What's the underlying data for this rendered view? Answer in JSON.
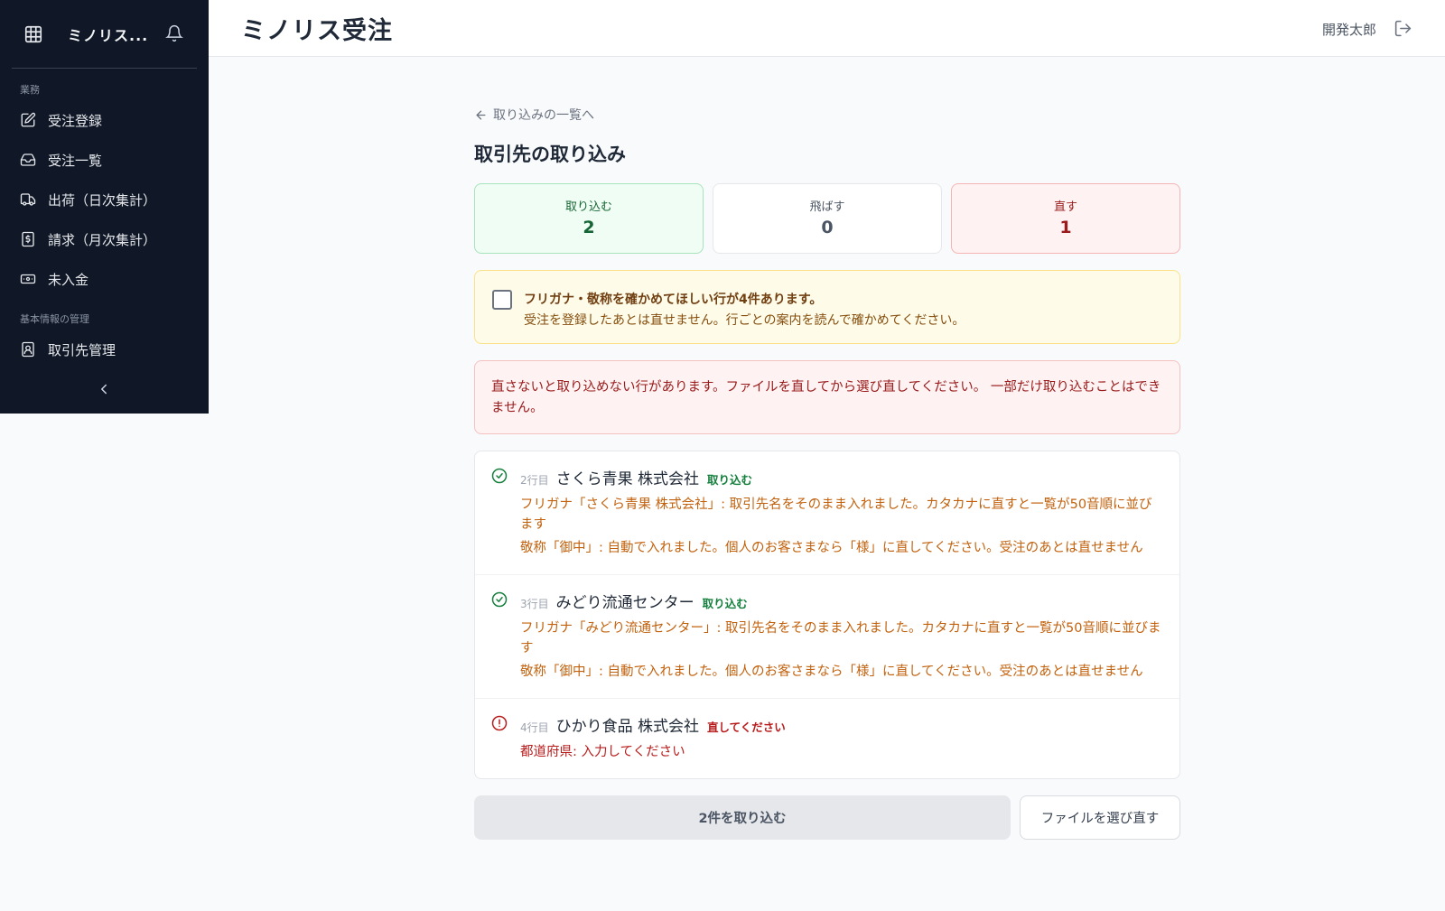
{
  "sidebar": {
    "app_name": "ミノリス...",
    "sections": [
      {
        "label": "業務",
        "items": [
          {
            "label": "受注登録",
            "icon": "edit-icon"
          },
          {
            "label": "受注一覧",
            "icon": "inbox-icon"
          },
          {
            "label": "出荷（日次集計）",
            "icon": "truck-icon"
          },
          {
            "label": "請求（月次集計）",
            "icon": "invoice-icon"
          },
          {
            "label": "未入金",
            "icon": "banknote-icon"
          }
        ]
      },
      {
        "label": "基本情報の管理",
        "items": [
          {
            "label": "取引先管理",
            "icon": "contact-icon"
          }
        ]
      }
    ]
  },
  "header": {
    "title": "ミノリス受注",
    "user_name": "開発太郎"
  },
  "main": {
    "back_link": "取り込みの一覧へ",
    "heading": "取引先の取り込み",
    "stats": [
      {
        "label": "取り込む",
        "value": "2",
        "tone": "green"
      },
      {
        "label": "飛ばす",
        "value": "0",
        "tone": "gray"
      },
      {
        "label": "直す",
        "value": "1",
        "tone": "red"
      }
    ],
    "warning": {
      "title": "フリガナ・敬称を確かめてほしい行が4件あります。",
      "subtitle": "受注を登録したあとは直せません。行ごとの案内を読んで確かめてください。"
    },
    "error": {
      "text": "直さないと取り込めない行があります。ファイルを直してから選び直してください。 一部だけ取り込むことはできません。"
    },
    "rows": [
      {
        "line": "2行目",
        "name": "さくら青果 株式会社",
        "status": "取り込む",
        "ok": true,
        "messages": [
          "フリガナ「さくら青果 株式会社」: 取引先名をそのまま入れました。カタカナに直すと一覧が50音順に並びます",
          "敬称「御中」: 自動で入れました。個人のお客さまなら「様」に直してください。受注のあとは直せません"
        ]
      },
      {
        "line": "3行目",
        "name": "みどり流通センター",
        "status": "取り込む",
        "ok": true,
        "messages": [
          "フリガナ「みどり流通センター」: 取引先名をそのまま入れました。カタカナに直すと一覧が50音順に並びます",
          "敬称「御中」: 自動で入れました。個人のお客さまなら「様」に直してください。受注のあとは直せません"
        ]
      },
      {
        "line": "4行目",
        "name": "ひかり食品 株式会社",
        "status": "直してください",
        "ok": false,
        "messages": [
          "都道府県: 入力してください"
        ]
      }
    ],
    "primary_button": "2件を取り込む",
    "secondary_button": "ファイルを選び直す"
  },
  "colors": {
    "sidebar_bg": "#101827",
    "ok_green": "#15803d",
    "error_red": "#b91c1c",
    "warn_orange": "#c2620e"
  }
}
